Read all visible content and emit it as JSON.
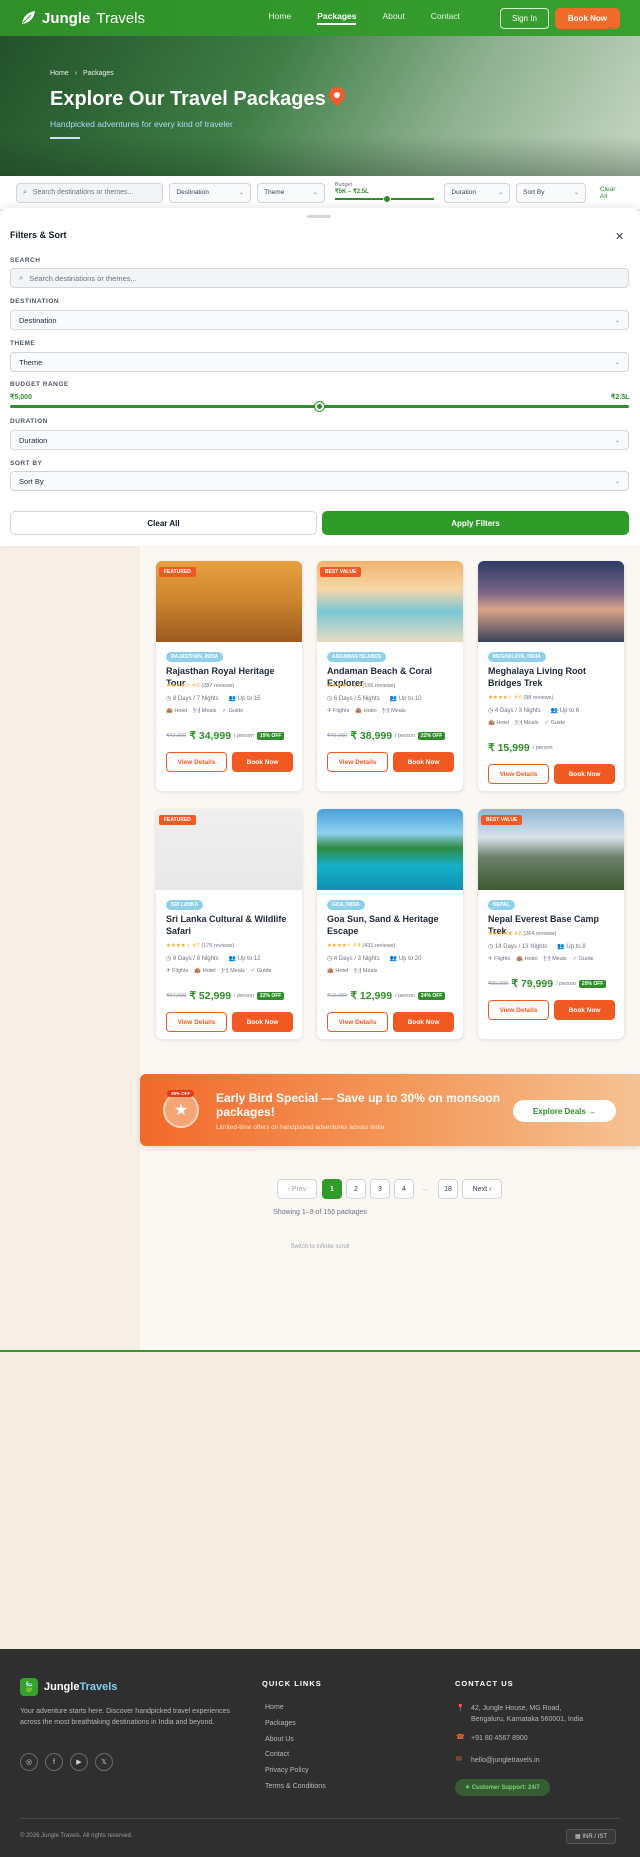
{
  "header": {
    "brand_main": "Jungle",
    "brand_sub": "Travels",
    "nav": [
      "Home",
      "Packages",
      "About",
      "Contact"
    ],
    "active_nav": "Packages",
    "sign_in": "Sign In",
    "book_now": "Book Now"
  },
  "hero": {
    "breadcrumb": [
      "Home",
      "Packages"
    ],
    "title": "Explore Our Travel Packages",
    "subtitle": "Handpicked adventures for every kind of traveler"
  },
  "filter_bar": {
    "search_placeholder": "Search destinations or themes...",
    "destination": "Destination",
    "theme": "Theme",
    "budget_label": "Budget",
    "budget_value": "₹5K – ₹2.5L",
    "duration": "Duration",
    "sort_by": "Sort By",
    "clear_all": "Clear All"
  },
  "sheet": {
    "title": "Filters & Sort",
    "search_label": "SEARCH",
    "search_placeholder": "Search destinations or themes...",
    "destination_label": "DESTINATION",
    "destination_value": "Destination",
    "theme_label": "THEME",
    "theme_value": "Theme",
    "budget_label": "BUDGET RANGE",
    "budget_min": "₹5,000",
    "budget_max": "₹2.5L",
    "budget_level_pct": 50,
    "duration_label": "DURATION",
    "duration_value": "Duration",
    "sort_label": "SORT BY",
    "sort_value": "Sort By",
    "clear": "Clear All",
    "apply": "Apply Filters"
  },
  "cards": [
    {
      "badge": "FEATURED",
      "location": "RAJASTHAN, INDIA",
      "title": "Rajasthan Royal Heritage Tour",
      "rating": "4.6",
      "reviews": "(287 reviews)",
      "duration": "8 Days / 7 Nights",
      "group": "Up to 15",
      "features": [
        "Hotel",
        "Meals",
        "Guide"
      ],
      "old_price": "₹42,999",
      "price": "₹ 34,999",
      "per": "/ person",
      "off": "19% OFF",
      "stars": 4.5
    },
    {
      "badge": "BEST VALUE",
      "location": "ANDAMAN ISLANDS",
      "title": "Andaman Beach & Coral Explorer",
      "rating": "4.5",
      "reviews": "(156 reviews)",
      "duration": "6 Days / 5 Nights",
      "group": "Up to 10",
      "features": [
        "Flights",
        "Hotel",
        "Meals"
      ],
      "old_price": "₹49,999",
      "price": "₹ 38,999",
      "per": "/ person",
      "off": "22% OFF",
      "stars": 4.5
    },
    {
      "badge": "",
      "location": "MEGHALAYA, INDIA",
      "title": "Meghalaya Living Root Bridges Trek",
      "rating": "4.6",
      "reviews": "(98 reviews)",
      "duration": "4 Days / 3 Nights",
      "group": "Up to 6",
      "features": [
        "Hotel",
        "Meals",
        "Guide"
      ],
      "old_price": "",
      "price": "₹ 15,999",
      "per": "/ person",
      "off": "",
      "stars": 4.5
    },
    {
      "badge": "FEATURED",
      "location": "SRI LANKA",
      "title": "Sri Lanka Cultural & Wildlife Safari",
      "rating": "4.7",
      "reviews": "(175 reviews)",
      "duration": "9 Days / 8 Nights",
      "group": "Up to 12",
      "features": [
        "Flights",
        "Hotel",
        "Meals",
        "Guide"
      ],
      "old_price": "₹67,999",
      "price": "₹ 52,999",
      "per": "/ person",
      "off": "22% OFF",
      "stars": 4.5
    },
    {
      "badge": "",
      "location": "GOA, INDIA",
      "title": "Goa Sun, Sand & Heritage Escape",
      "rating": "4.4",
      "reviews": "(431 reviews)",
      "duration": "4 Days / 3 Nights",
      "group": "Up to 20",
      "features": [
        "Hotel",
        "Meals"
      ],
      "old_price": "₹16,999",
      "price": "₹ 12,999",
      "per": "/ person",
      "off": "24% OFF",
      "stars": 4.5
    },
    {
      "badge": "BEST VALUE",
      "location": "NEPAL",
      "title": "Nepal Everest Base Camp Trek",
      "rating": "4.8",
      "reviews": "(264 reviews)",
      "duration": "14 Days / 13 Nights",
      "group": "Up to 8",
      "features": [
        "Flights",
        "Hotel",
        "Meals",
        "Guide"
      ],
      "old_price": "₹99,999",
      "price": "₹ 79,999",
      "per": "/ person",
      "off": "20% OFF",
      "stars": 5
    }
  ],
  "card_buttons": {
    "view": "View Details",
    "book": "Book Now"
  },
  "promo": {
    "tag": "30% OFF",
    "title": "Early Bird Special — Save up to 30% on monsoon packages!",
    "subtitle": "Limited-time offers on handpicked adventures across India",
    "button": "Explore Deals →"
  },
  "pagination": {
    "prev": "‹ Prev",
    "pages": [
      "1",
      "2",
      "3",
      "4"
    ],
    "dots": "...",
    "last": "18",
    "next": "Next ›",
    "info": "Showing 1–9 of 156 packages",
    "toggle": "Switch to infinite scroll"
  },
  "footer": {
    "brand_main": "Jungle",
    "brand_sub": "Travels",
    "description": "Your adventure starts here. Discover handpicked travel experiences across the most breathtaking destinations in India and beyond.",
    "quick_links_title": "QUICK LINKS",
    "quick_links": [
      "Home",
      "Packages",
      "About Us",
      "Contact",
      "Privacy Policy",
      "Terms & Conditions"
    ],
    "contact_title": "CONTACT US",
    "address_1": "42, Jungle House, MG Road,",
    "address_2": "Bengaluru, Karnataka 560001, India",
    "phone": "+91 80 4567 8900",
    "email": "hello@jungletravels.in",
    "support": "Customer Support: 24/7",
    "copyright": "© 2026 Jungle Travels. All rights reserved.",
    "currency": "INR / IST"
  },
  "colors": {
    "brand_green": "#2f8f2a",
    "accent_orange": "#f05a22",
    "footer_bg": "#2f2f2f"
  }
}
